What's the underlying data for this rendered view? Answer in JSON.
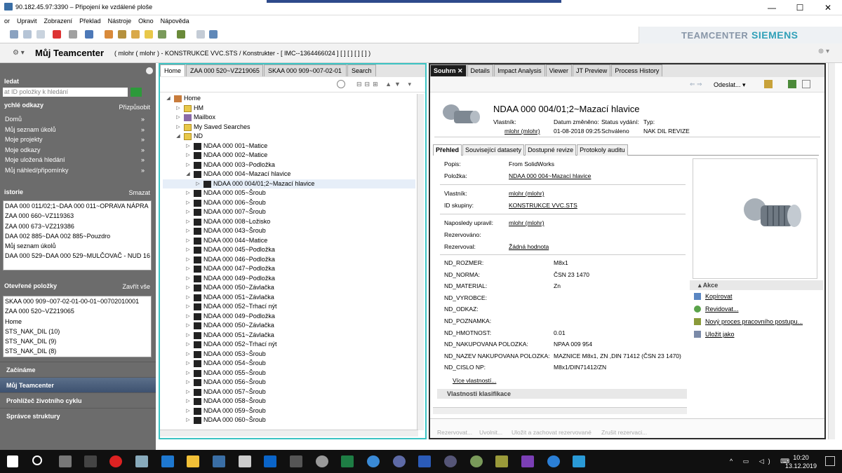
{
  "window": {
    "title": "90.182.45.97:3390 – Připojení ke vzdálené ploše",
    "min": "—",
    "max": "☐",
    "close": "✕"
  },
  "menu": [
    "or",
    "Upravit",
    "Zobrazení",
    "Překlad",
    "Nástroje",
    "Okno",
    "Nápověda"
  ],
  "brand": {
    "left": "TEAMCENTER",
    "right": "SIEMENS"
  },
  "header": {
    "title": "Můj Teamcenter",
    "context": "( mlohr ( mlohr ) - KONSTRUKCE VVC.STS / Konstrukter - [ IMC--1364466024 ] [ ] [ ] [ ] [ ] )"
  },
  "left": {
    "search": {
      "title": "ledat",
      "placeholder": "at ID položky k hledání"
    },
    "quick": {
      "title": "ychlé odkazy",
      "action": "Přizpůsobit",
      "items": [
        "Domů",
        "Můj seznam úkolů",
        "Moje projekty",
        "Moje odkazy",
        "Moje uložená hledání",
        "Můj náhled/připomínky"
      ]
    },
    "history": {
      "title": "istorie",
      "action": "Smazat",
      "items": [
        "DAA 000 011/02;1~DAA 000 011~OPRAVA NÁPRA",
        "ZAA 000 660~VZ119363",
        "ZAA 000 673~VZ219386",
        "DAA 002 885~DAA 002 885~Pouzdro",
        "Můj seznam úkolů",
        "DAA 000 529~DAA 000 529~MULČOVAČ - NUD 16"
      ]
    },
    "open": {
      "title": "Otevřené položky",
      "action": "Zavřít vše",
      "items": [
        "SKAA 000 909~007-02-01-00-01~00702010001",
        "ZAA 000 520~VZ219065",
        "Home",
        "STS_NAK_DIL (10)",
        "STS_NAK_DIL (9)",
        "STS_NAK_DIL (8)"
      ]
    },
    "nav": [
      "Začínáme",
      "Můj Teamcenter",
      "Prohlížeč životního cyklu",
      "Správce struktury"
    ]
  },
  "midTabs": [
    "Home",
    "ZAA 000 520~VZ219065",
    "SKAA 000 909~007-02-01",
    "Search"
  ],
  "tree": [
    {
      "l": 0,
      "a": "◢",
      "t": "Home",
      "k": "home"
    },
    {
      "l": 1,
      "a": "▷",
      "t": "HM",
      "k": "fold"
    },
    {
      "l": 1,
      "a": "▷",
      "t": "Mailbox",
      "k": "mail"
    },
    {
      "l": 1,
      "a": "▷",
      "t": "My Saved Searches",
      "k": "fold"
    },
    {
      "l": 1,
      "a": "◢",
      "t": "ND",
      "k": "fold"
    },
    {
      "l": 2,
      "a": "▷",
      "t": "NDAA 000 001~Matice",
      "k": "nd"
    },
    {
      "l": 2,
      "a": "▷",
      "t": "NDAA 000 002~Matice",
      "k": "nd"
    },
    {
      "l": 2,
      "a": "▷",
      "t": "NDAA 000 003~Podložka",
      "k": "nd"
    },
    {
      "l": 2,
      "a": "◢",
      "t": "NDAA 000 004~Mazací hlavice",
      "k": "nd"
    },
    {
      "l": 3,
      "a": "▷",
      "t": "NDAA 000 004/01;2~Mazací hlavice",
      "k": "nd",
      "sel": true
    },
    {
      "l": 2,
      "a": "▷",
      "t": "NDAA 000 005~Šroub",
      "k": "nd"
    },
    {
      "l": 2,
      "a": "▷",
      "t": "NDAA 000 006~Šroub",
      "k": "nd"
    },
    {
      "l": 2,
      "a": "▷",
      "t": "NDAA 000 007~Šroub",
      "k": "nd"
    },
    {
      "l": 2,
      "a": "▷",
      "t": "NDAA 000 008~Ložisko",
      "k": "nd"
    },
    {
      "l": 2,
      "a": "▷",
      "t": "NDAA 000 043~Šroub",
      "k": "nd"
    },
    {
      "l": 2,
      "a": "▷",
      "t": "NDAA 000 044~Matice",
      "k": "nd"
    },
    {
      "l": 2,
      "a": "▷",
      "t": "NDAA 000 045~Podložka",
      "k": "nd"
    },
    {
      "l": 2,
      "a": "▷",
      "t": "NDAA 000 046~Podložka",
      "k": "nd"
    },
    {
      "l": 2,
      "a": "▷",
      "t": "NDAA 000 047~Podložka",
      "k": "nd"
    },
    {
      "l": 2,
      "a": "▷",
      "t": "NDAA 000 049~Podložka",
      "k": "nd"
    },
    {
      "l": 2,
      "a": "▷",
      "t": "NDAA 000 050~Závlačka",
      "k": "nd"
    },
    {
      "l": 2,
      "a": "▷",
      "t": "NDAA 000 051~Závlačka",
      "k": "nd"
    },
    {
      "l": 2,
      "a": "▷",
      "t": "NDAA 000 052~Trhací nýt",
      "k": "nd"
    },
    {
      "l": 2,
      "a": "▷",
      "t": "NDAA 000 049~Podložka",
      "k": "nd"
    },
    {
      "l": 2,
      "a": "▷",
      "t": "NDAA 000 050~Závlačka",
      "k": "nd"
    },
    {
      "l": 2,
      "a": "▷",
      "t": "NDAA 000 051~Závlačka",
      "k": "nd"
    },
    {
      "l": 2,
      "a": "▷",
      "t": "NDAA 000 052~Trhací nýt",
      "k": "nd"
    },
    {
      "l": 2,
      "a": "▷",
      "t": "NDAA 000 053~Šroub",
      "k": "nd"
    },
    {
      "l": 2,
      "a": "▷",
      "t": "NDAA 000 054~Šroub",
      "k": "nd"
    },
    {
      "l": 2,
      "a": "▷",
      "t": "NDAA 000 055~Šroub",
      "k": "nd"
    },
    {
      "l": 2,
      "a": "▷",
      "t": "NDAA 000 056~Šroub",
      "k": "nd"
    },
    {
      "l": 2,
      "a": "▷",
      "t": "NDAA 000 057~Šroub",
      "k": "nd"
    },
    {
      "l": 2,
      "a": "▷",
      "t": "NDAA 000 058~Šroub",
      "k": "nd"
    },
    {
      "l": 2,
      "a": "▷",
      "t": "NDAA 000 059~Šroub",
      "k": "nd"
    },
    {
      "l": 2,
      "a": "▷",
      "t": "NDAA 000 060~Šroub",
      "k": "nd"
    }
  ],
  "rightTabs": [
    "Souhrn",
    "Details",
    "Impact Analysis",
    "Viewer",
    "JT Preview",
    "Process History"
  ],
  "summary": {
    "send": "Odeslat...",
    "title": "NDAA 000 004/01;2~Mazací hlavice",
    "metaLabels": [
      "Vlastník:",
      "Datum změněno:",
      "Status vydání:",
      "Typ:"
    ],
    "owner": "mlohr (mlohr)",
    "date": "01-08-2018 09:25",
    "status": "Schváleno",
    "type": "NAK DIL REVIZE",
    "subtabs": [
      "Přehled",
      "Související datasety",
      "Dostupné revize",
      "Protokoly auditu"
    ],
    "props1": [
      {
        "k": "Popis:",
        "v": "From SolidWorks",
        "link": false
      },
      {
        "k": "Položka:",
        "v": "NDAA 000 004~Mazací hlavice",
        "link": true
      }
    ],
    "props2": [
      {
        "k": "Vlastník:",
        "v": "mlohr (mlohr)",
        "link": true
      },
      {
        "k": "ID skupiny:",
        "v": "KONSTRUKCE VVC.STS",
        "link": true
      }
    ],
    "props3": [
      {
        "k": "Naposledy upravil:",
        "v": "mlohr (mlohr)",
        "link": true
      },
      {
        "k": "Rezervováno:",
        "v": "",
        "link": false
      },
      {
        "k": "Rezervoval:",
        "v": "Žádná hodnota",
        "link": true
      }
    ],
    "nd": [
      {
        "k": "ND_ROZMER:",
        "v": "M8x1"
      },
      {
        "k": "ND_NORMA:",
        "v": "ČSN 23 1470"
      },
      {
        "k": "ND_MATERIAL:",
        "v": "Zn"
      },
      {
        "k": "ND_VYROBCE:",
        "v": ""
      },
      {
        "k": "ND_ODKAZ:",
        "v": ""
      },
      {
        "k": "ND_POZNAMKA:",
        "v": ""
      },
      {
        "k": "ND_HMOTNOST:",
        "v": "0.01"
      },
      {
        "k": "ND_NAKUPOVANA POLOZKA:",
        "v": "NPAA 009 954"
      },
      {
        "k": "ND_NAZEV NAKUPOVANA POLOZKA:",
        "v": "MAZNICE M8x1, ZN ,DIN 71412 (ČSN 23 1470)"
      },
      {
        "k": "ND_CISLO NP:",
        "v": "M8x1/DIN71412/ZN"
      }
    ],
    "more": "Více vlastností...",
    "classif": "Vlastnosti klasifikace",
    "akce": "Akce",
    "actions": [
      "Kopírovat",
      "Revidovat...",
      "Nový proces pracovního postupu...",
      "Uložit jako"
    ],
    "bottom": [
      "Rezervovat...",
      "Uvolnit...",
      "Uložit a zachovat rezervované",
      "Zrušit rezervaci..."
    ]
  },
  "clock": {
    "time": "10:20",
    "date": "13.12.2019"
  }
}
